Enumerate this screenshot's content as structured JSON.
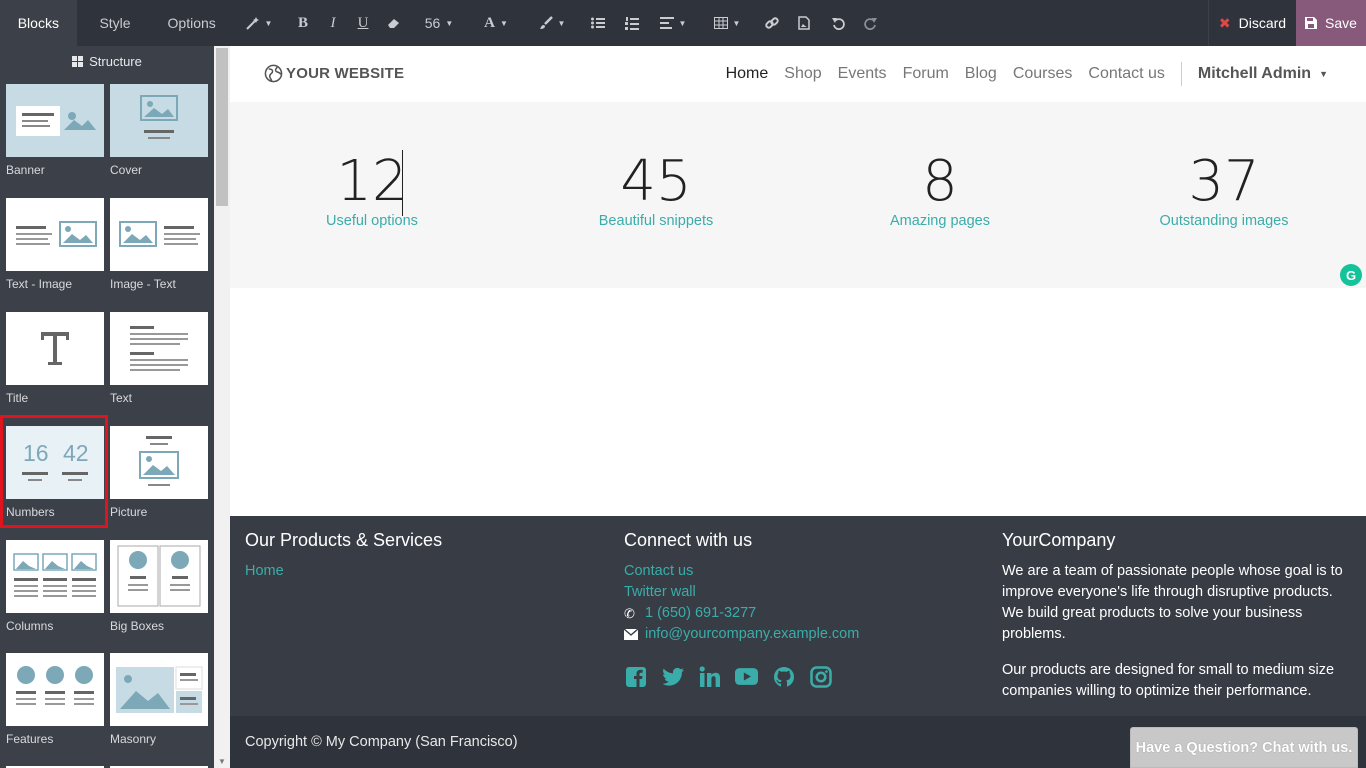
{
  "sidebar": {
    "tabs": [
      {
        "label": "Blocks"
      },
      {
        "label": "Style"
      },
      {
        "label": "Options"
      }
    ],
    "section_title": "Structure",
    "snippets": [
      {
        "label": "Banner"
      },
      {
        "label": "Cover"
      },
      {
        "label": "Text - Image"
      },
      {
        "label": "Image - Text"
      },
      {
        "label": "Title"
      },
      {
        "label": "Text"
      },
      {
        "label": "Numbers",
        "numbers": [
          "16",
          "42"
        ],
        "selected": true
      },
      {
        "label": "Picture"
      },
      {
        "label": "Columns"
      },
      {
        "label": "Big Boxes"
      },
      {
        "label": "Features"
      },
      {
        "label": "Masonry"
      }
    ]
  },
  "toolbar": {
    "font_size": "56",
    "discard_label": "Discard",
    "save_label": "Save",
    "save_color": "#875a7b"
  },
  "site": {
    "logo_text": "YOUR WEBSITE",
    "nav": [
      {
        "label": "Home",
        "active": true
      },
      {
        "label": "Shop"
      },
      {
        "label": "Events"
      },
      {
        "label": "Forum"
      },
      {
        "label": "Blog"
      },
      {
        "label": "Courses"
      },
      {
        "label": "Contact us"
      }
    ],
    "user": "Mitchell Admin",
    "numbers": [
      {
        "value": "12",
        "label": "Useful options"
      },
      {
        "value": "45",
        "label": "Beautiful snippets"
      },
      {
        "value": "8",
        "label": "Amazing pages"
      },
      {
        "value": "37",
        "label": "Outstanding images"
      }
    ],
    "accent_color": "#3aadaa"
  },
  "footer": {
    "col1": {
      "title": "Our Products & Services",
      "links": [
        "Home"
      ]
    },
    "col2": {
      "title": "Connect with us",
      "links": [
        "Contact us",
        "Twitter wall"
      ],
      "phone": "1 (650) 691-3277",
      "email": "info@yourcompany.example.com",
      "social": [
        "facebook-icon",
        "twitter-icon",
        "linkedin-icon",
        "youtube-icon",
        "github-icon",
        "instagram-icon"
      ]
    },
    "col3": {
      "title": "YourCompany",
      "p1": "We are a team of passionate people whose goal is to improve everyone's life through disruptive products. We build great products to solve your business problems.",
      "p2": "Our products are designed for small to medium size companies willing to optimize their performance."
    },
    "copyright": "Copyright © My Company (San Francisco)",
    "chat_label": "Have a Question? Chat with us."
  }
}
